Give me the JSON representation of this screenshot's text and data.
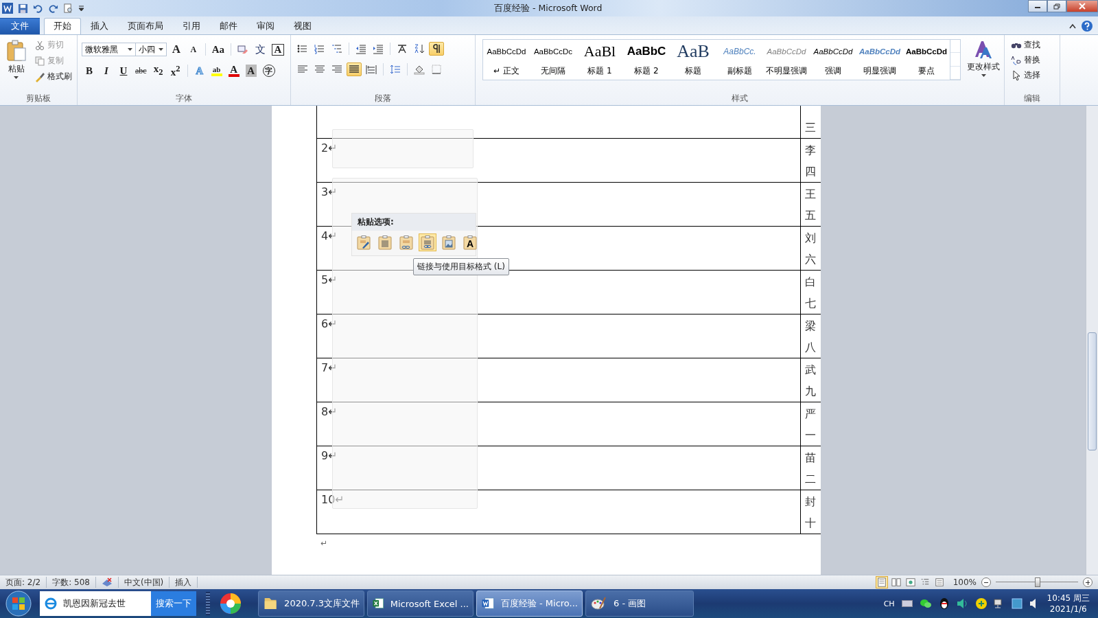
{
  "title_bar": {
    "title": "百度经验 - Microsoft Word"
  },
  "tabs": [
    {
      "label": "文件",
      "kind": "file",
      "selected": false
    },
    {
      "label": "开始",
      "kind": "tab",
      "selected": true
    },
    {
      "label": "插入",
      "kind": "tab",
      "selected": false
    },
    {
      "label": "页面布局",
      "kind": "tab",
      "selected": false
    },
    {
      "label": "引用",
      "kind": "tab",
      "selected": false
    },
    {
      "label": "邮件",
      "kind": "tab",
      "selected": false
    },
    {
      "label": "审阅",
      "kind": "tab",
      "selected": false
    },
    {
      "label": "视图",
      "kind": "tab",
      "selected": false
    }
  ],
  "clipboard": {
    "paste": "粘贴",
    "group_label": "剪贴板",
    "items": [
      {
        "label": "剪切",
        "kind": "cut",
        "disabled": true
      },
      {
        "label": "复制",
        "kind": "copy",
        "disabled": true
      },
      {
        "label": "格式刷",
        "kind": "brush",
        "disabled": false
      }
    ]
  },
  "font": {
    "font_name": "微软雅黑",
    "font_size": "小四",
    "group_label": "字体",
    "row1": [
      {
        "kind": "grow",
        "glyph": "A"
      },
      {
        "kind": "shrink",
        "glyph": "A"
      },
      {
        "kind": "case",
        "glyph": "Aa"
      },
      {
        "kind": "clear"
      },
      {
        "kind": "phonetic",
        "glyph": "文"
      },
      {
        "kind": "border",
        "glyph": "A"
      }
    ],
    "row2": [
      {
        "kind": "bold",
        "glyph": "B"
      },
      {
        "kind": "italic",
        "glyph": "I"
      },
      {
        "kind": "underline",
        "glyph": "U"
      },
      {
        "kind": "strike",
        "glyph": "abc"
      },
      {
        "kind": "subscript",
        "glyph": "x$_{2}$"
      },
      {
        "kind": "superscript",
        "glyph": "x$^{2}$"
      },
      {
        "kind": "effect",
        "glyph": "A"
      },
      {
        "kind": "highlight",
        "glyph": "ab"
      },
      {
        "kind": "color",
        "glyph": "A"
      },
      {
        "kind": "shading",
        "glyph": "A"
      },
      {
        "kind": "enclose",
        "glyph": "字"
      }
    ]
  },
  "paragraph": {
    "group_label": "段落",
    "row1": [
      {
        "kind": "bullets",
        "selected": false
      },
      {
        "kind": "numbering",
        "selected": false
      },
      {
        "kind": "multilevel",
        "selected": false
      },
      {
        "kind": "outdent",
        "selected": false
      },
      {
        "kind": "indent",
        "selected": false
      },
      {
        "kind": "asian-layout",
        "selected": false
      },
      {
        "kind": "sort",
        "selected": false
      },
      {
        "kind": "show-marks",
        "selected": true
      }
    ],
    "row2": [
      {
        "kind": "align-left",
        "selected": false
      },
      {
        "kind": "align-center",
        "selected": false
      },
      {
        "kind": "align-right",
        "selected": false
      },
      {
        "kind": "justify",
        "selected": true
      },
      {
        "kind": "distribute",
        "selected": false
      },
      {
        "kind": "line-spacing",
        "selected": false
      },
      {
        "kind": "fill",
        "selected": false
      },
      {
        "kind": "borders",
        "selected": false
      }
    ]
  },
  "styles": {
    "group_label": "样式",
    "change_styles": "更改样式",
    "items": [
      {
        "preview": "AaBbCcDd",
        "label": "↵ 正文",
        "kind": "normal"
      },
      {
        "preview": "AaBbCcDc",
        "label": "无间隔",
        "kind": "normal"
      },
      {
        "preview": "AaBl",
        "label": "标题 1",
        "kind": "heading1"
      },
      {
        "preview": "AaBbC",
        "label": "标题 2",
        "kind": "heading2"
      },
      {
        "preview": "AaB",
        "label": "标题",
        "kind": "title"
      },
      {
        "preview": "AaBbCc.",
        "label": "副标题",
        "kind": "subtitle"
      },
      {
        "preview": "AaBbCcDd",
        "label": "不明显强调",
        "kind": "subtle"
      },
      {
        "preview": "AaBbCcDd",
        "label": "强调",
        "kind": "emphasis"
      },
      {
        "preview": "AaBbCcDd",
        "label": "明显强调",
        "kind": "intense"
      },
      {
        "preview": "AaBbCcDd",
        "label": "要点",
        "kind": "strong"
      }
    ]
  },
  "editing": {
    "group_label": "编辑",
    "items": [
      {
        "label": "查找",
        "kind": "find"
      },
      {
        "label": "替换",
        "kind": "replace"
      },
      {
        "label": "选择",
        "kind": "select"
      }
    ]
  },
  "document": {
    "end_mark": "↵",
    "rows": [
      {
        "name": "三"
      },
      {
        "number": "2↵",
        "name": "李四"
      },
      {
        "number": "3↵",
        "name": "王五"
      },
      {
        "number": "4↵",
        "name": "刘六"
      },
      {
        "number": "5↵",
        "name": "白七"
      },
      {
        "number": "6↵",
        "name": "梁八"
      },
      {
        "number": "7↵",
        "name": "武九"
      },
      {
        "number": "8↵",
        "name": "严一"
      },
      {
        "number": "9↵",
        "name": "苗二"
      },
      {
        "number": "10↵",
        "name": "封十"
      }
    ]
  },
  "paste_menu": {
    "title": "粘贴选项:",
    "tooltip": "链接与使用目标格式 (L)",
    "options": [
      {
        "kind": "keep-source",
        "selected": false
      },
      {
        "kind": "merge",
        "selected": false
      },
      {
        "kind": "link-source",
        "selected": false
      },
      {
        "kind": "link-dest",
        "selected": true
      },
      {
        "kind": "picture",
        "selected": false
      },
      {
        "kind": "text-only",
        "glyph": "A",
        "selected": false
      }
    ]
  },
  "status_bar": {
    "items": [
      {
        "kind": "text",
        "text": "页面: 2/2"
      },
      {
        "kind": "text",
        "text": "字数: 508"
      },
      {
        "kind": "proofing"
      },
      {
        "kind": "text",
        "text": "中文(中国)"
      },
      {
        "kind": "text",
        "text": "插入"
      }
    ],
    "views": [
      {
        "kind": "print",
        "selected": true
      },
      {
        "kind": "reading",
        "selected": false
      },
      {
        "kind": "web",
        "selected": false
      },
      {
        "kind": "outline",
        "selected": false
      },
      {
        "kind": "draft",
        "selected": false
      }
    ],
    "zoom": "100%",
    "zoom_slider": {
      "level": 0.5
    }
  },
  "taskbar": {
    "search_value": "凯恩因新冠去世",
    "search_button": "搜索一下",
    "tasks": [
      {
        "label": "2020.7.3文库文件",
        "kind": "folder",
        "selected": false
      },
      {
        "label": "Microsoft Excel ...",
        "kind": "excel",
        "selected": false
      },
      {
        "label": "百度经验 - Micro...",
        "kind": "word",
        "selected": true
      },
      {
        "label": "6 - 画图",
        "kind": "paint",
        "selected": false
      }
    ],
    "tray_lang": "CH",
    "time": "10:45 周三",
    "date": "2021/1/6"
  }
}
